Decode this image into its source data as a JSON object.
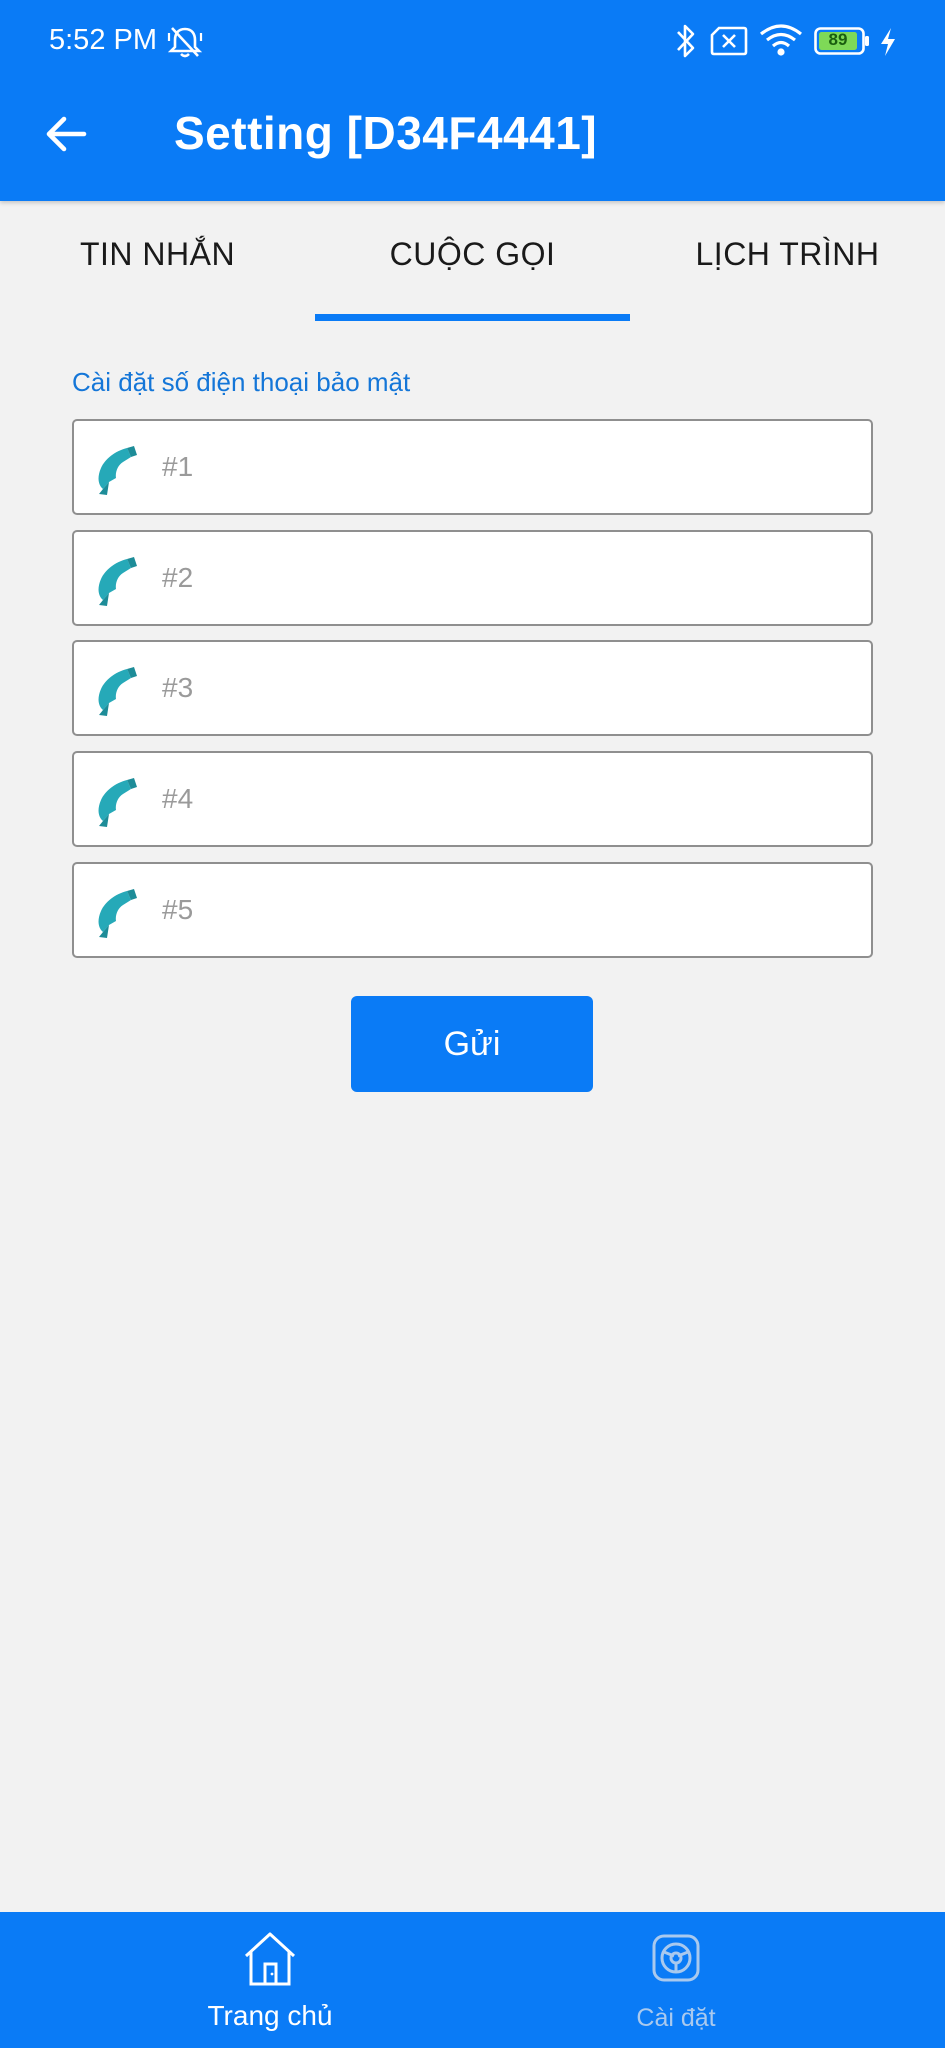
{
  "status_bar": {
    "time": "5:52 PM",
    "battery": "89",
    "icons": [
      "mute-alarm-icon",
      "bluetooth-icon",
      "sim-off-icon",
      "wifi-icon",
      "battery-icon",
      "charging-bolt-icon"
    ]
  },
  "header": {
    "title": "Setting [D34F4441]",
    "back_icon": "arrow-left-icon"
  },
  "tabs": [
    {
      "label": "TIN NHẮN",
      "active": false
    },
    {
      "label": "CUỘC GỌI",
      "active": true
    },
    {
      "label": "LỊCH TRÌNH",
      "active": false
    }
  ],
  "section": {
    "label": "Cài đặt số điện thoại bảo mật"
  },
  "phone_fields": [
    {
      "placeholder": "#1",
      "value": ""
    },
    {
      "placeholder": "#2",
      "value": ""
    },
    {
      "placeholder": "#3",
      "value": ""
    },
    {
      "placeholder": "#4",
      "value": ""
    },
    {
      "placeholder": "#5",
      "value": ""
    }
  ],
  "send_button": {
    "label": "Gửi"
  },
  "bottom_nav": {
    "items": [
      {
        "label": "Trang chủ",
        "icon": "home-icon",
        "active": true
      },
      {
        "label": "Cài đặt",
        "icon": "settings-icon",
        "active": false
      }
    ]
  },
  "colors": {
    "primary": "#0a7bf6",
    "background": "#f2f2f2",
    "section_label": "#1476d8",
    "phone_icon": "#26a9b8"
  }
}
